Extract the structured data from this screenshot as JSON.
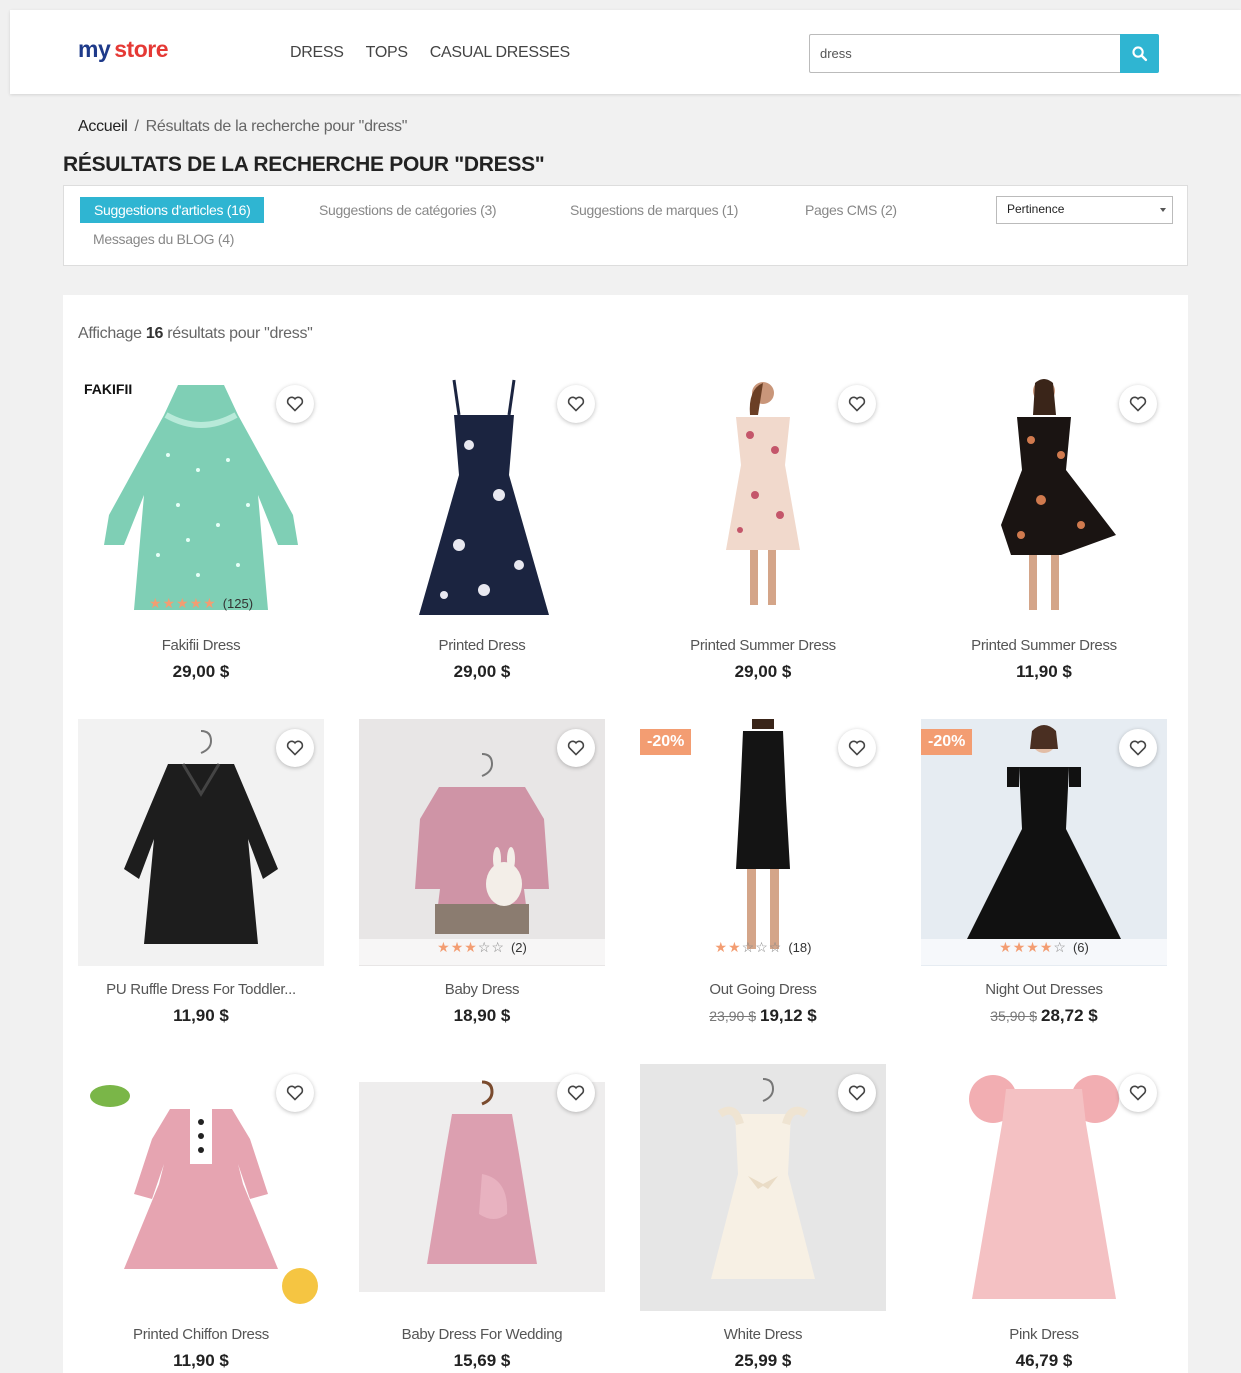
{
  "header": {
    "logo_my": "my",
    "logo_store": "store",
    "nav": [
      "DRESS",
      "TOPS",
      "CASUAL DRESSES"
    ],
    "search_value": "dress"
  },
  "breadcrumb": {
    "home": "Accueil",
    "sep": "/",
    "current": "Résultats de la recherche pour \"dress\""
  },
  "page_title": "RÉSULTATS DE LA RECHERCHE POUR \"DRESS\"",
  "tabs": [
    "Suggestions d'articles (16)",
    "Suggestions de catégories (3)",
    "Suggestions de marques (1)",
    "Pages CMS (2)",
    "Messages du BLOG (4)"
  ],
  "sort": {
    "selected": "Pertinence"
  },
  "results": {
    "prefix": "Affichage",
    "count": "16",
    "suffix": "résultats pour \"dress\""
  },
  "products": [
    {
      "name": "Fakifii Dress",
      "price": "29,00 $",
      "brand": "FAKIFII",
      "rating": 5,
      "reviews": "(125)"
    },
    {
      "name": "Printed Dress",
      "price": "29,00 $"
    },
    {
      "name": "Printed Summer Dress",
      "price": "29,00 $"
    },
    {
      "name": "Printed Summer Dress",
      "price": "11,90 $"
    },
    {
      "name": "PU Ruffle Dress For Toddler...",
      "price": "11,90 $"
    },
    {
      "name": "Baby Dress",
      "price": "18,90 $",
      "rating": 3,
      "reviews": "(2)"
    },
    {
      "name": "Out Going Dress",
      "old_price": "23,90 $",
      "price": "19,12 $",
      "badge": "-20%",
      "rating": 2,
      "reviews": "(18)"
    },
    {
      "name": "Night Out Dresses",
      "old_price": "35,90 $",
      "price": "28,72 $",
      "badge": "-20%",
      "rating": 4,
      "reviews": "(6)"
    },
    {
      "name": "Printed Chiffon Dress",
      "price": "11,90 $"
    },
    {
      "name": "Baby Dress For Wedding",
      "price": "15,69 $"
    },
    {
      "name": "White Dress",
      "price": "25,99 $"
    },
    {
      "name": "Pink Dress",
      "price": "46,79 $"
    }
  ]
}
